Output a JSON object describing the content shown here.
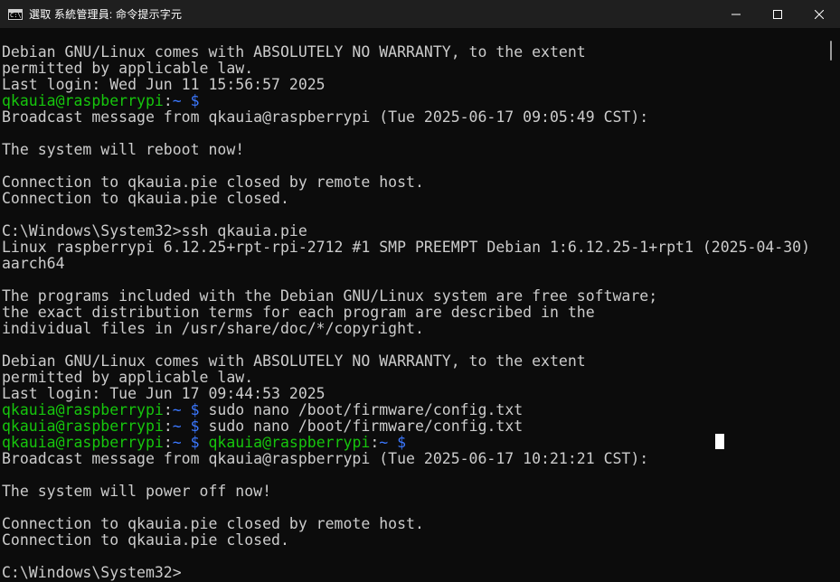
{
  "window": {
    "title": "選取 系統管理員: 命令提示字元",
    "icon_name": "cmd-icon",
    "icon_text": "C:\\"
  },
  "terminal": {
    "colors": {
      "background": "#0c0c0c",
      "text": "#cccccc",
      "user": "#16c60c",
      "path": "#3b78ff",
      "cursor": "#ffffff"
    },
    "lines": [
      {
        "segments": [
          {
            "t": "Debian GNU/Linux comes with ABSOLUTELY NO WARRANTY, to the extent",
            "c": "text"
          }
        ]
      },
      {
        "segments": [
          {
            "t": "permitted by applicable law.",
            "c": "text"
          }
        ]
      },
      {
        "segments": [
          {
            "t": "Last login: Wed Jun 11 15:56:57 2025",
            "c": "text"
          }
        ]
      },
      {
        "segments": [
          {
            "t": "qkauia@raspberrypi",
            "c": "user"
          },
          {
            "t": ":",
            "c": "text"
          },
          {
            "t": "~",
            "c": "path"
          },
          {
            "t": " $",
            "c": "sym"
          }
        ]
      },
      {
        "segments": [
          {
            "t": "Broadcast message from qkauia@raspberrypi (Tue 2025-06-17 09:05:49 CST):",
            "c": "text"
          }
        ]
      },
      {
        "segments": [
          {
            "t": "",
            "c": "text"
          }
        ]
      },
      {
        "segments": [
          {
            "t": "The system will reboot now!",
            "c": "text"
          }
        ]
      },
      {
        "segments": [
          {
            "t": "",
            "c": "text"
          }
        ]
      },
      {
        "segments": [
          {
            "t": "Connection to qkauia.pie closed by remote host.",
            "c": "text"
          }
        ]
      },
      {
        "segments": [
          {
            "t": "Connection to qkauia.pie closed.",
            "c": "text"
          }
        ]
      },
      {
        "segments": [
          {
            "t": "",
            "c": "text"
          }
        ]
      },
      {
        "segments": [
          {
            "t": "C:\\Windows\\System32>ssh qkauia.pie",
            "c": "text"
          }
        ]
      },
      {
        "segments": [
          {
            "t": "Linux raspberrypi 6.12.25+rpt-rpi-2712 #1 SMP PREEMPT Debian 1:6.12.25-1+rpt1 (2025-04-30)",
            "c": "text"
          }
        ]
      },
      {
        "segments": [
          {
            "t": "aarch64",
            "c": "text"
          }
        ]
      },
      {
        "segments": [
          {
            "t": "",
            "c": "text"
          }
        ]
      },
      {
        "segments": [
          {
            "t": "The programs included with the Debian GNU/Linux system are free software;",
            "c": "text"
          }
        ]
      },
      {
        "segments": [
          {
            "t": "the exact distribution terms for each program are described in the",
            "c": "text"
          }
        ]
      },
      {
        "segments": [
          {
            "t": "individual files in /usr/share/doc/*/copyright.",
            "c": "text"
          }
        ]
      },
      {
        "segments": [
          {
            "t": "",
            "c": "text"
          }
        ]
      },
      {
        "segments": [
          {
            "t": "Debian GNU/Linux comes with ABSOLUTELY NO WARRANTY, to the extent",
            "c": "text"
          }
        ]
      },
      {
        "segments": [
          {
            "t": "permitted by applicable law.",
            "c": "text"
          }
        ]
      },
      {
        "segments": [
          {
            "t": "Last login: Tue Jun 17 09:44:53 2025",
            "c": "text"
          }
        ]
      },
      {
        "segments": [
          {
            "t": "qkauia@raspberrypi",
            "c": "user"
          },
          {
            "t": ":",
            "c": "text"
          },
          {
            "t": "~",
            "c": "path"
          },
          {
            "t": " $",
            "c": "sym"
          },
          {
            "t": " sudo nano /boot/firmware/config.txt",
            "c": "text"
          }
        ]
      },
      {
        "segments": [
          {
            "t": "qkauia@raspberrypi",
            "c": "user"
          },
          {
            "t": ":",
            "c": "text"
          },
          {
            "t": "~",
            "c": "path"
          },
          {
            "t": " $",
            "c": "sym"
          },
          {
            "t": " sudo nano /boot/firmware/config.txt",
            "c": "text"
          }
        ]
      },
      {
        "segments": [
          {
            "t": "qkauia@raspberrypi",
            "c": "user"
          },
          {
            "t": ":",
            "c": "text"
          },
          {
            "t": "~",
            "c": "path"
          },
          {
            "t": " $",
            "c": "sym"
          },
          {
            "t": " ",
            "c": "text"
          },
          {
            "t": "qkauia@raspberrypi",
            "c": "user"
          },
          {
            "t": ":",
            "c": "text"
          },
          {
            "t": "~",
            "c": "path"
          },
          {
            "t": " $",
            "c": "sym"
          }
        ]
      },
      {
        "segments": [
          {
            "t": "Broadcast message from qkauia@raspberrypi (Tue 2025-06-17 10:21:21 CST):",
            "c": "text"
          }
        ]
      },
      {
        "segments": [
          {
            "t": "",
            "c": "text"
          }
        ]
      },
      {
        "segments": [
          {
            "t": "The system will power off now!",
            "c": "text"
          }
        ]
      },
      {
        "segments": [
          {
            "t": "",
            "c": "text"
          }
        ]
      },
      {
        "segments": [
          {
            "t": "Connection to qkauia.pie closed by remote host.",
            "c": "text"
          }
        ]
      },
      {
        "segments": [
          {
            "t": "Connection to qkauia.pie closed.",
            "c": "text"
          }
        ]
      },
      {
        "segments": [
          {
            "t": "",
            "c": "text"
          }
        ]
      },
      {
        "segments": [
          {
            "t": "C:\\Windows\\System32>",
            "c": "text"
          }
        ]
      }
    ]
  }
}
